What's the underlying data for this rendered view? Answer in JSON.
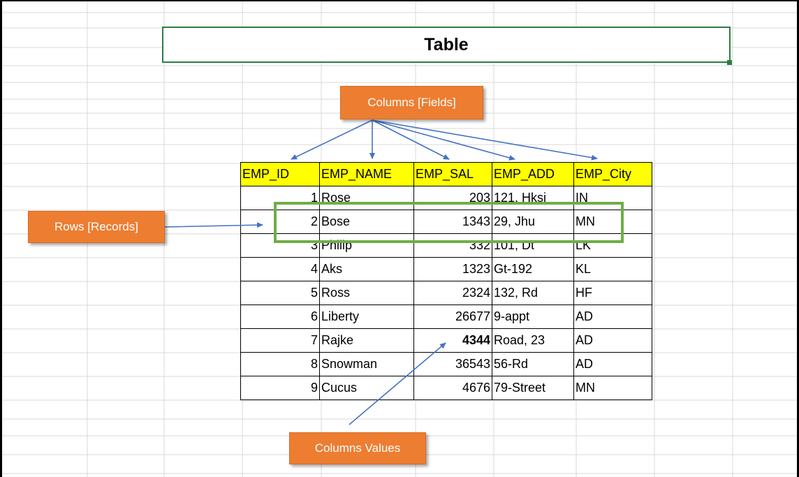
{
  "title": "Table",
  "callouts": {
    "columns": "Columns [Fields]",
    "rows": "Rows [Records]",
    "values": "Columns Values"
  },
  "headers": [
    "EMP_ID",
    "EMP_NAME",
    "EMP_SAL",
    "EMP_ADD",
    "EMP_City"
  ],
  "rows": [
    [
      "1",
      "Rose",
      "203",
      "121, Hksi",
      "IN"
    ],
    [
      "2",
      "Bose",
      "1343",
      "29, Jhu",
      "MN"
    ],
    [
      "3",
      "Philip",
      "332",
      "101, Dt",
      "LK"
    ],
    [
      "4",
      "Aks",
      "1323",
      "Gt-192",
      "KL"
    ],
    [
      "5",
      "Ross",
      "2324",
      "132, Rd",
      "HF"
    ],
    [
      "6",
      "Liberty",
      "26677",
      "9-appt",
      "AD"
    ],
    [
      "7",
      "Rajke",
      "4344",
      "Road, 23",
      "AD"
    ],
    [
      "8",
      "Snowman",
      "36543",
      "56-Rd",
      "AD"
    ],
    [
      "9",
      "Cucus",
      "4676",
      "79-Street",
      "MN"
    ]
  ],
  "colors": {
    "header_fill": "#ffff00",
    "callout_fill": "#ed7d31",
    "highlight_border": "#70ad47",
    "arrow": "#4472c4",
    "title_border": "#2e7d43"
  }
}
